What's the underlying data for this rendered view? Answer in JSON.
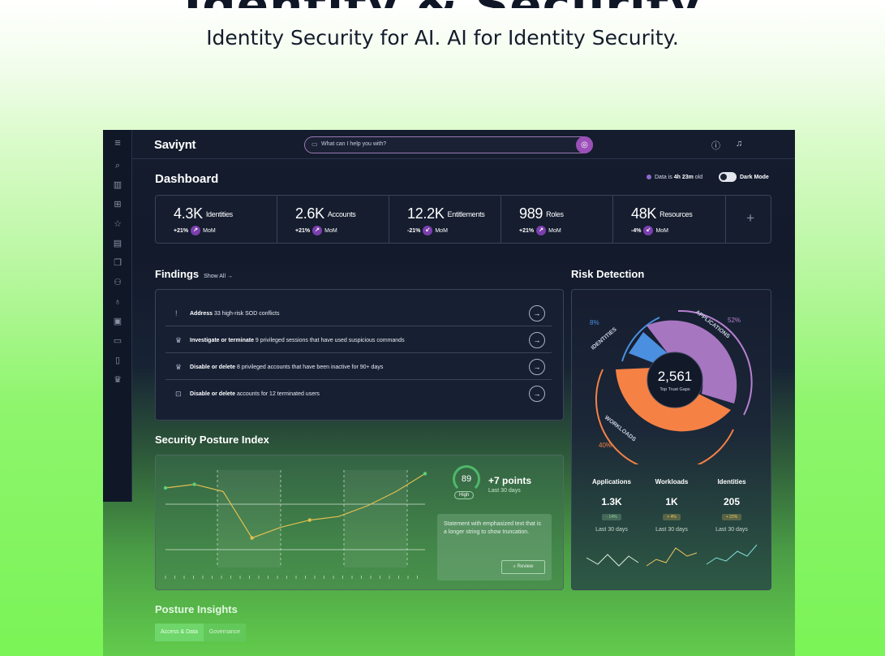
{
  "hero": {
    "partial_heading": "Identity & Security",
    "tagline": "Identity Security for AI. AI for Identity Security."
  },
  "app": {
    "logo": "Saviynt",
    "search": {
      "placeholder": "What can I help you with?"
    },
    "dashboard_title": "Dashboard",
    "data_age": {
      "prefix": "Data is ",
      "value": "4h 23m",
      "suffix": " old"
    },
    "dark_mode": "Dark Mode",
    "kpis": [
      {
        "value": "4.3K",
        "label": "Identities",
        "delta": "+21%",
        "arrow": "↗",
        "period": "MoM"
      },
      {
        "value": "2.6K",
        "label": "Accounts",
        "delta": "+21%",
        "arrow": "↗",
        "period": "MoM"
      },
      {
        "value": "12.2K",
        "label": "Entitlements",
        "delta": "-21%",
        "arrow": "↙",
        "period": "MoM"
      },
      {
        "value": "989",
        "label": "Roles",
        "delta": "+21%",
        "arrow": "↗",
        "period": "MoM"
      },
      {
        "value": "48K",
        "label": "Resources",
        "delta": "-4%",
        "arrow": "↙",
        "period": "MoM"
      }
    ],
    "findings": {
      "title": "Findings",
      "show_all": "Show All →",
      "items": [
        {
          "icon": "!",
          "bold": "Address",
          "rest": " 33 high-risk SOD conflicts"
        },
        {
          "icon": "♛",
          "bold": "Investigate or terminate",
          "rest": " 9 privileged sessions that have used suspicious commands"
        },
        {
          "icon": "♛",
          "bold": "Disable or delete",
          "rest": " 8 privileged accounts that have been inactive for 90+ days"
        },
        {
          "icon": "⊡",
          "bold": "Disable or delete",
          "rest": " accounts for 12 terminated users"
        }
      ]
    },
    "posture": {
      "title": "Security Posture Index",
      "score": "89",
      "level": "High",
      "points": "+7 points",
      "period": "Last 30 days",
      "statement": "Statement with emphasized text that is a longer string to show truncation.",
      "review": "Review",
      "chart_data": {
        "type": "line",
        "values": [
          40,
          42,
          38,
          12,
          18,
          22,
          24,
          30,
          38,
          48
        ]
      }
    },
    "risk": {
      "title": "Risk Detection",
      "center_value": "2,561",
      "center_label": "Top Trust Gaps",
      "segments": [
        {
          "name": "IDENTITIES",
          "pct": "8%",
          "color": "#4b8fe0"
        },
        {
          "name": "APPLICATIONS",
          "pct": "52%",
          "color": "#b77fd0"
        },
        {
          "name": "WORKLOADS",
          "pct": "40%",
          "color": "#f58145"
        }
      ],
      "stats": [
        {
          "label": "Applications",
          "value": "1.3K",
          "delta": "- 14%",
          "period": "Last 30 days",
          "color": "#9fd6a6"
        },
        {
          "label": "Workloads",
          "value": "1K",
          "delta": "+ 4%",
          "period": "Last 30 days",
          "color": "#f0c860"
        },
        {
          "label": "Identities",
          "value": "205",
          "delta": "+ 23%",
          "period": "Last 30 days",
          "color": "#f0c860"
        }
      ]
    },
    "insights": {
      "title": "Posture Insights",
      "tabs": [
        "Access & Data",
        "Governance"
      ]
    }
  }
}
